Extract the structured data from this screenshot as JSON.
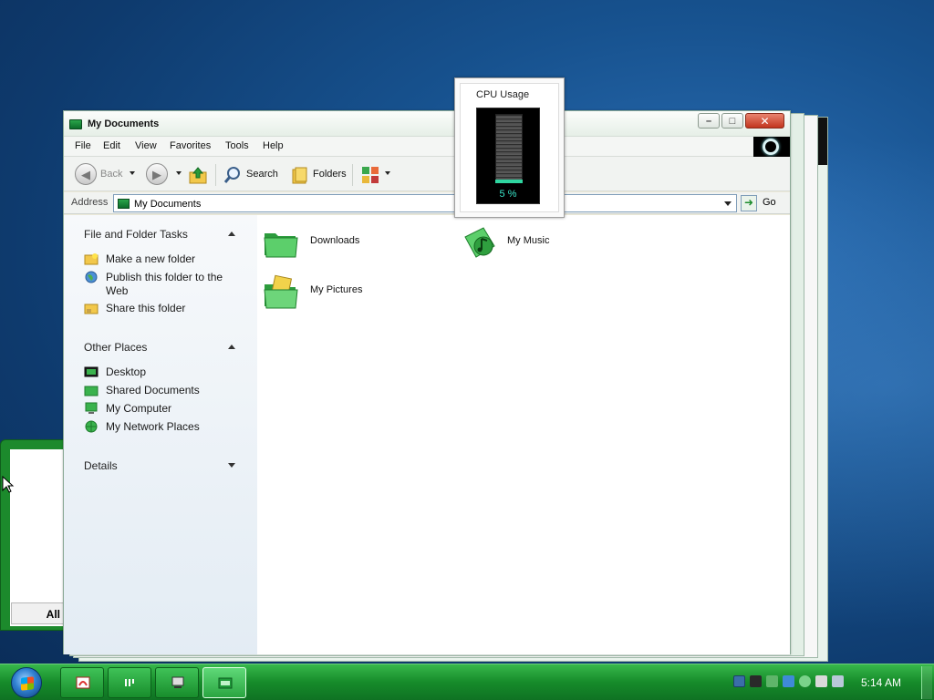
{
  "window": {
    "title": "My Documents",
    "menu": [
      "File",
      "Edit",
      "View",
      "Favorites",
      "Tools",
      "Help"
    ],
    "toolbar": {
      "back": "Back",
      "search": "Search",
      "folders": "Folders"
    },
    "address": {
      "label": "Address",
      "value": "My Documents",
      "go": "Go"
    },
    "taskpane": {
      "file_tasks": {
        "title": "File and Folder Tasks",
        "items": [
          "Make a new folder",
          "Publish this folder to the Web",
          "Share this folder"
        ]
      },
      "other_places": {
        "title": "Other Places",
        "items": [
          "Desktop",
          "Shared Documents",
          "My Computer",
          "My Network Places"
        ]
      },
      "details": {
        "title": "Details"
      }
    },
    "folders": [
      {
        "label": "Downloads",
        "icon": "folder-icon"
      },
      {
        "label": "My Music",
        "icon": "music-folder-icon"
      },
      {
        "label": "My Pictures",
        "icon": "pictures-folder-icon"
      }
    ]
  },
  "gadget": {
    "title": "CPU Usage",
    "percent_text": "5 %",
    "usage_fraction": 0.05
  },
  "left_window": {
    "button": "All"
  },
  "taskbar": {
    "clock": "5:14 AM",
    "buttons": [
      "pdf-reader-icon",
      "media-icon",
      "computer-icon",
      "my-documents-icon"
    ],
    "tray_icons": [
      "square-icon",
      "network-icon",
      "usb-icon",
      "security-icon",
      "sync-icon",
      "volume-icon",
      "printer-icon",
      "keyboard-icon"
    ]
  },
  "colors": {
    "accent_green": "#168b2a",
    "meter_green": "#2fd5a0",
    "desktop_blue": "#17528f"
  }
}
